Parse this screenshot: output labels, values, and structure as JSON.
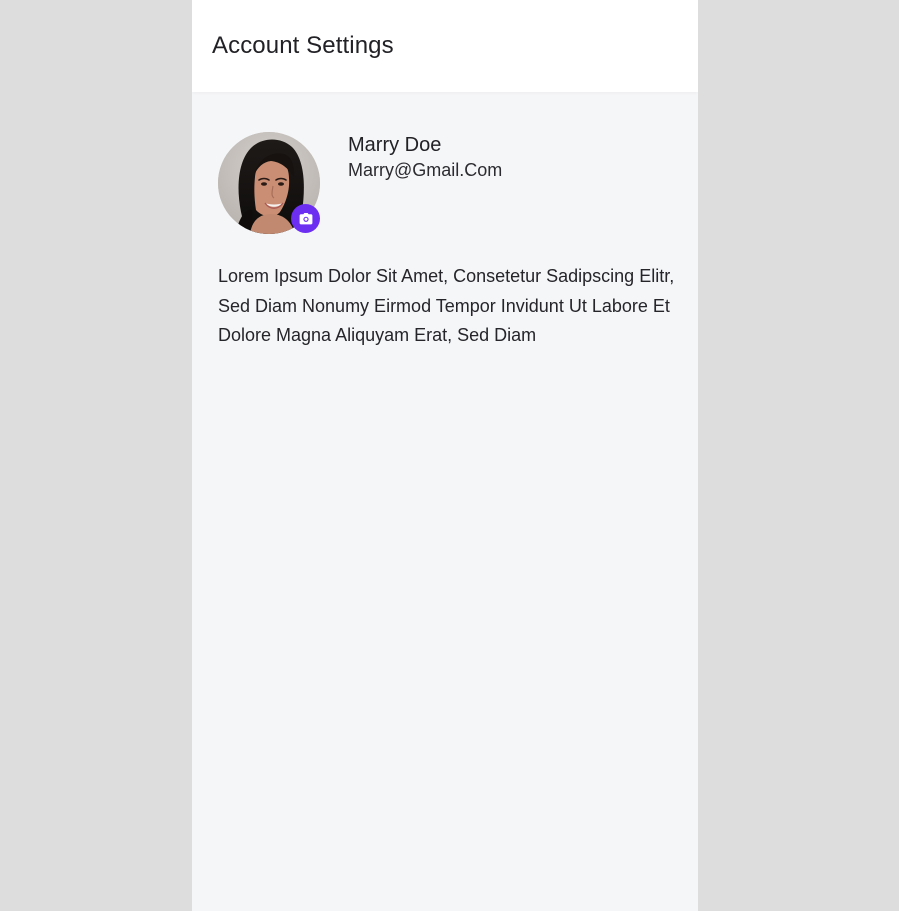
{
  "header": {
    "title": "Account Settings"
  },
  "profile": {
    "name": "Marry Doe",
    "email": "Marry@Gmail.Com",
    "avatar_icon": "profile-photo",
    "camera_icon": "camera-icon"
  },
  "bio": {
    "text": "Lorem Ipsum Dolor Sit Amet, Consetetur Sadipscing Elitr, Sed Diam Nonumy Eirmod Tempor Invidunt Ut Labore Et Dolore Magna Aliquyam Erat, Sed Diam"
  },
  "colors": {
    "accent": "#6c2ff2",
    "background": "#f5f6f8",
    "header": "#ffffff",
    "outside": "#dddddd"
  }
}
